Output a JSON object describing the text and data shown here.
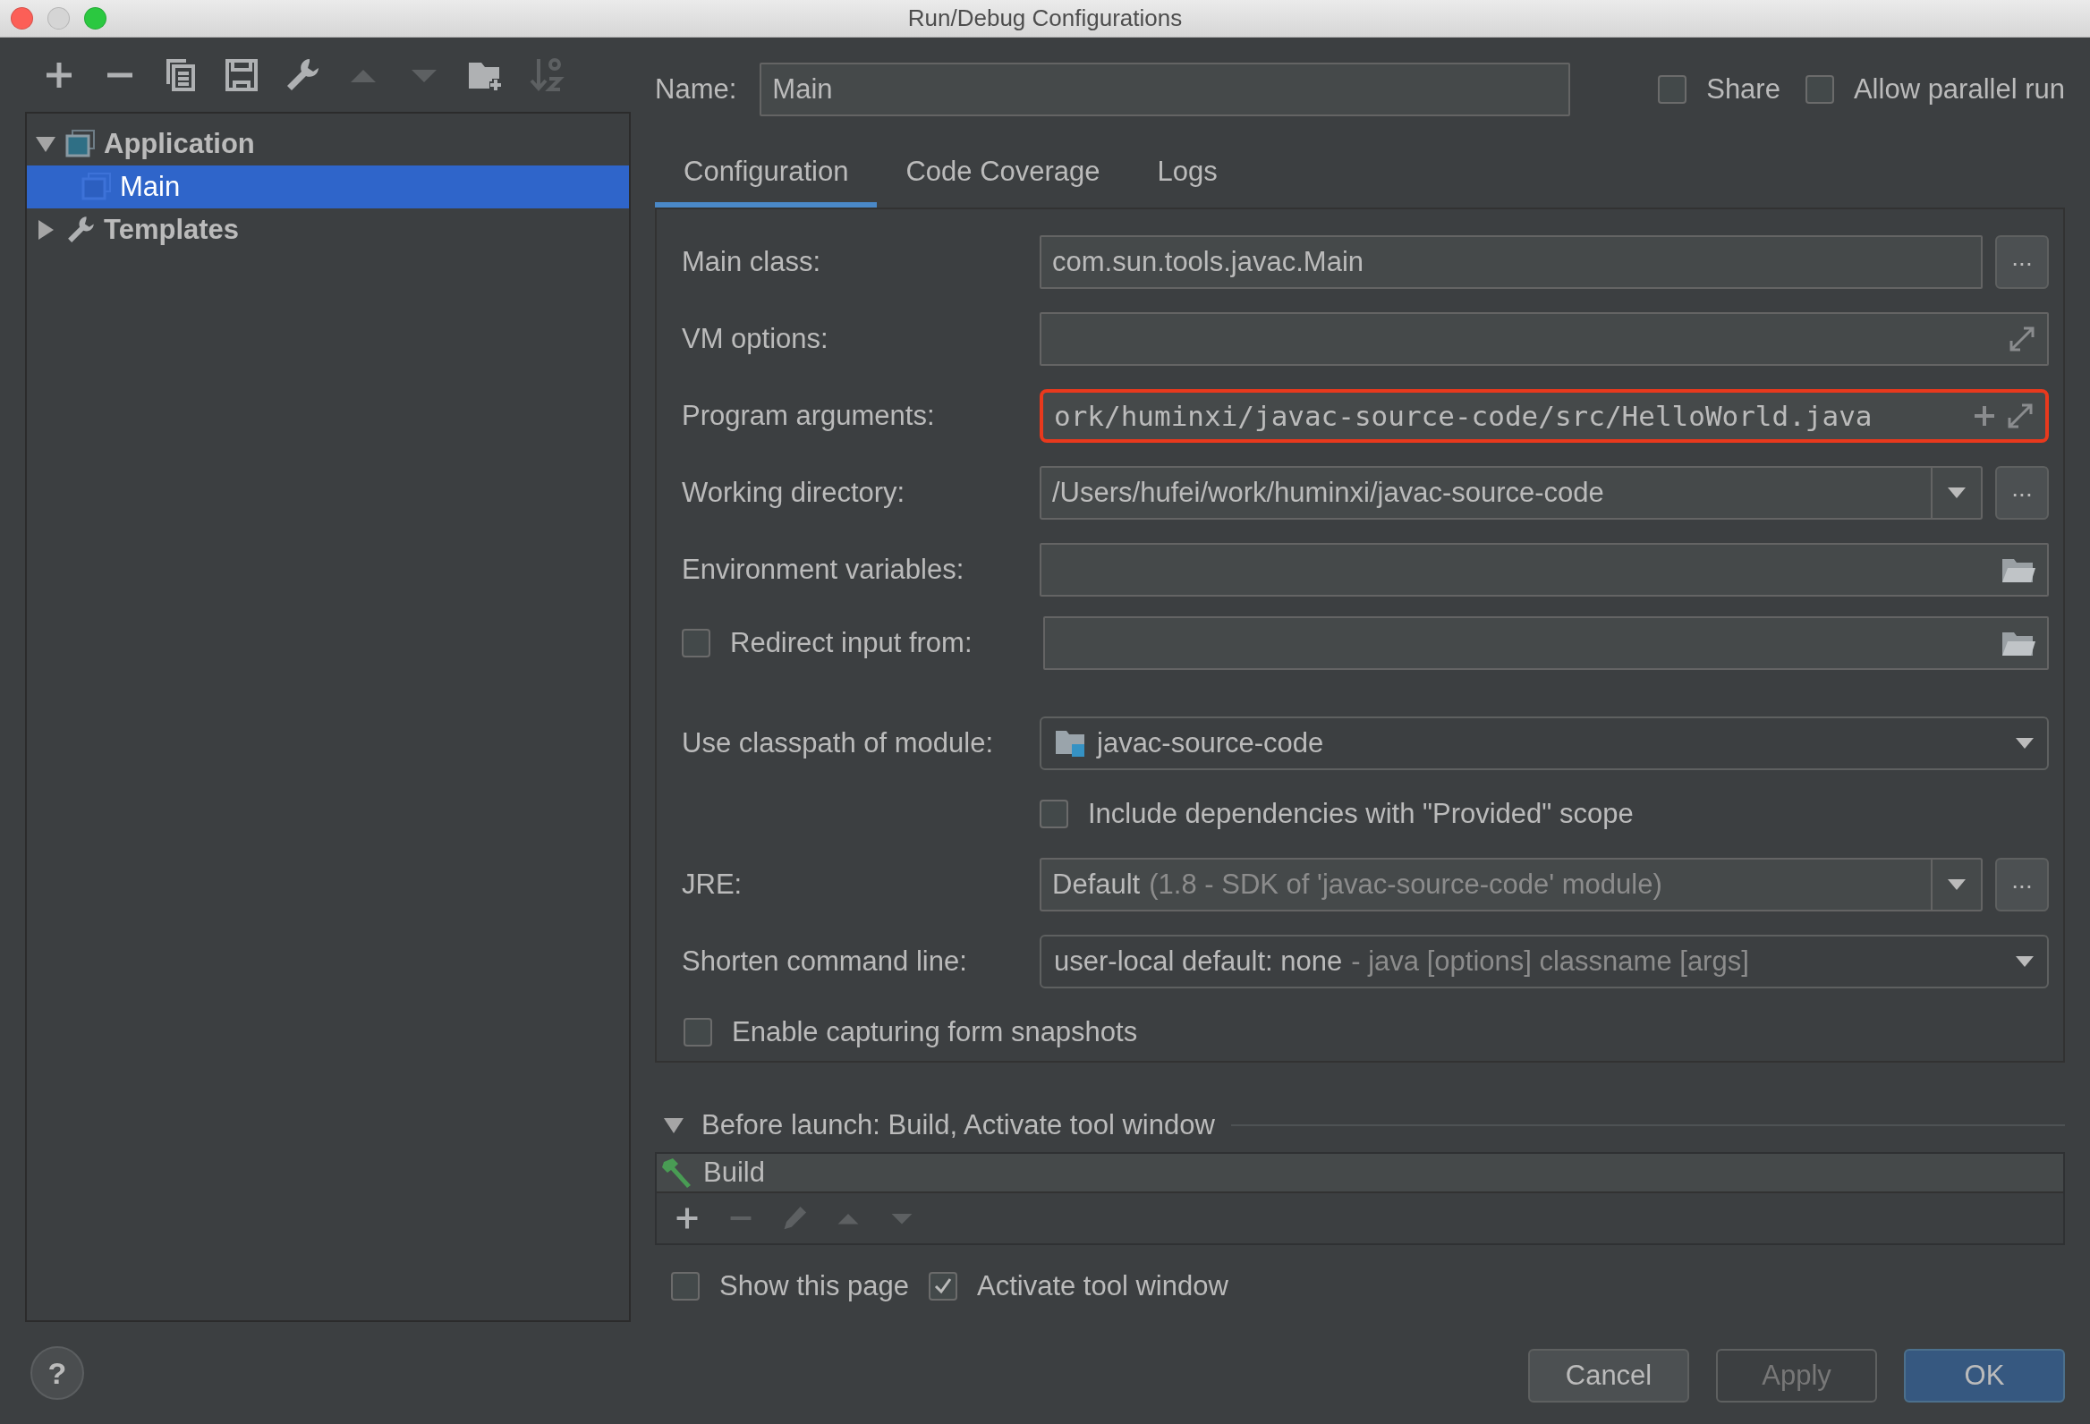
{
  "window": {
    "title": "Run/Debug Configurations"
  },
  "toolbar": [
    {
      "kind": "add",
      "disabled": false
    },
    {
      "kind": "remove",
      "disabled": false
    },
    {
      "kind": "copy",
      "disabled": false
    },
    {
      "kind": "save",
      "disabled": false
    },
    {
      "kind": "wrench",
      "disabled": false
    },
    {
      "kind": "up",
      "disabled": true
    },
    {
      "kind": "down",
      "disabled": true
    },
    {
      "kind": "folder",
      "disabled": false
    },
    {
      "kind": "sort",
      "disabled": true
    }
  ],
  "tree": [
    {
      "label": "Application",
      "kind": "application",
      "expanded": true,
      "selected": false,
      "children": [
        {
          "label": "Main",
          "kind": "application",
          "selected": true
        }
      ]
    },
    {
      "label": "Templates",
      "kind": "templates",
      "expanded": false,
      "selected": false
    }
  ],
  "name": {
    "label": "Name:",
    "value": "Main"
  },
  "header_options": [
    {
      "label": "Share",
      "checked": false
    },
    {
      "label": "Allow parallel run",
      "checked": false
    }
  ],
  "tabs": [
    {
      "label": "Configuration",
      "selected": true
    },
    {
      "label": "Code Coverage",
      "selected": false
    },
    {
      "label": "Logs",
      "selected": false
    }
  ],
  "form": [
    {
      "kind": "field",
      "label": "Main class:",
      "value": "com.sun.tools.javac.Main",
      "browse": "..."
    },
    {
      "kind": "field",
      "label": "VM options:",
      "expand": true
    },
    {
      "kind": "field",
      "label": "Program arguments:",
      "value": "ork/huminxi/javac-source-code/src/HelloWorld.java",
      "mono": true,
      "highlighted": true,
      "add": true,
      "expand": true
    },
    {
      "kind": "combo",
      "label": "Working directory:",
      "value": "/Users/hufei/work/huminxi/javac-source-code",
      "browse": "..."
    },
    {
      "kind": "field",
      "label": "Environment variables:",
      "folder": true
    },
    {
      "kind": "checkfield",
      "label": "Redirect input from:",
      "checked": false,
      "folder": true
    },
    {
      "kind": "select",
      "label": "Use classpath of module:",
      "value": "javac-source-code",
      "module": true
    },
    {
      "kind": "subcheckbox",
      "label": "Include dependencies with \"Provided\" scope",
      "checked": false
    },
    {
      "kind": "combo",
      "label": "JRE:",
      "value": "Default",
      "hint": "(1.8 - SDK of 'javac-source-code' module)",
      "browse": "..."
    },
    {
      "kind": "select",
      "label": "Shorten command line:",
      "value": "user-local default: none",
      "hint": "- java [options] classname [args]"
    },
    {
      "kind": "checkbox",
      "label": "Enable capturing form snapshots",
      "checked": false
    }
  ],
  "before_launch": {
    "title": "Before launch: Build, Activate tool window",
    "expanded": true,
    "tasks": [
      {
        "label": "Build"
      }
    ],
    "tools": [
      {
        "kind": "add",
        "disabled": false
      },
      {
        "kind": "remove",
        "disabled": true
      },
      {
        "kind": "edit",
        "disabled": true
      },
      {
        "kind": "up",
        "disabled": true
      },
      {
        "kind": "down",
        "disabled": true
      }
    ],
    "options": [
      {
        "label": "Show this page",
        "checked": false
      },
      {
        "label": "Activate tool window",
        "checked": true
      }
    ]
  },
  "help": "?",
  "buttons": [
    {
      "label": "Cancel",
      "kind": "normal"
    },
    {
      "label": "Apply",
      "kind": "disabled"
    },
    {
      "label": "OK",
      "kind": "default"
    }
  ]
}
